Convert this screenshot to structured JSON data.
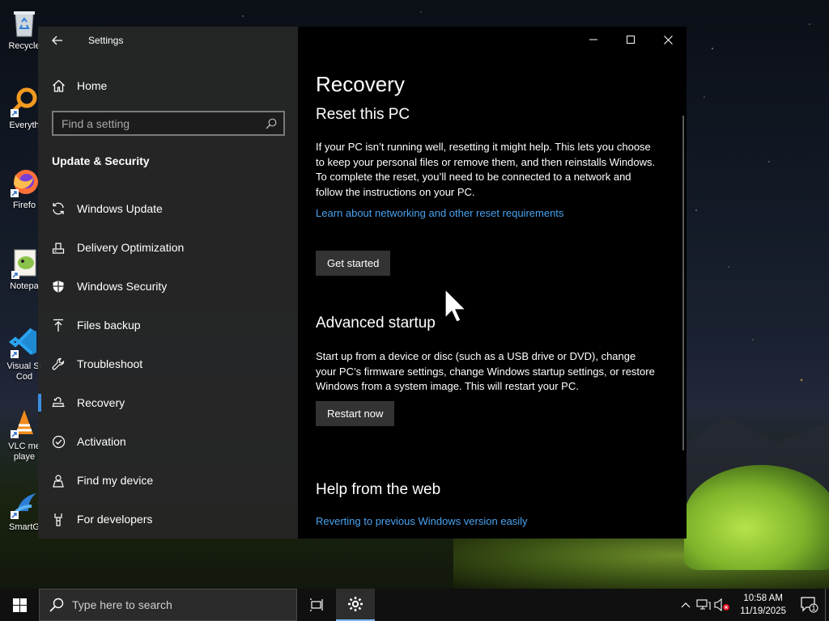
{
  "desktop": {
    "icons": [
      {
        "label": "Recycle",
        "icon": "recycle-bin-icon"
      },
      {
        "label": "Everyth",
        "icon": "everything-search-icon"
      },
      {
        "label": "Firefo",
        "icon": "firefox-icon"
      },
      {
        "label": "Notepa",
        "icon": "notepad-plus-plus-icon"
      },
      {
        "label": "Visual St Cod",
        "icon": "vscode-icon"
      },
      {
        "label": "VLC me playe",
        "icon": "vlc-icon"
      },
      {
        "label": "SmartG",
        "icon": "smartgit-icon"
      }
    ]
  },
  "window": {
    "title": "Settings",
    "home_label": "Home",
    "search_placeholder": "Find a setting",
    "section_heading": "Update & Security",
    "nav": [
      {
        "label": "Windows Update",
        "icon": "sync-icon",
        "active": false
      },
      {
        "label": "Delivery Optimization",
        "icon": "delivery-optimization-icon",
        "active": false
      },
      {
        "label": "Windows Security",
        "icon": "shield-icon",
        "active": false
      },
      {
        "label": "Files backup",
        "icon": "backup-arrow-icon",
        "active": false
      },
      {
        "label": "Troubleshoot",
        "icon": "wrench-icon",
        "active": false
      },
      {
        "label": "Recovery",
        "icon": "recovery-icon",
        "active": true
      },
      {
        "label": "Activation",
        "icon": "check-circle-icon",
        "active": false
      },
      {
        "label": "Find my device",
        "icon": "person-pin-icon",
        "active": false
      },
      {
        "label": "For developers",
        "icon": "developer-tools-icon",
        "active": false
      }
    ]
  },
  "recovery": {
    "page_title": "Recovery",
    "reset": {
      "heading": "Reset this PC",
      "text": "If your PC isn’t running well, resetting it might help. This lets you choose to keep your personal files or remove them, and then reinstalls Windows. To complete the reset, you’ll need to be connected to a network and follow the instructions on your PC.",
      "link": "Learn about networking and other reset requirements",
      "button": "Get started"
    },
    "advanced": {
      "heading": "Advanced startup",
      "text": "Start up from a device or disc (such as a USB drive or DVD), change your PC’s firmware settings, change Windows startup settings, or restore Windows from a system image. This will restart your PC.",
      "button": "Restart now"
    },
    "help": {
      "heading": "Help from the web",
      "link": "Reverting to previous Windows version easily"
    }
  },
  "taskbar": {
    "search_placeholder": "Type here to search",
    "time": "10:58 AM",
    "date": "11/19/2025",
    "notification_count": "1"
  },
  "colors": {
    "accent": "#3b8ee0",
    "link": "#4aa3f0"
  }
}
